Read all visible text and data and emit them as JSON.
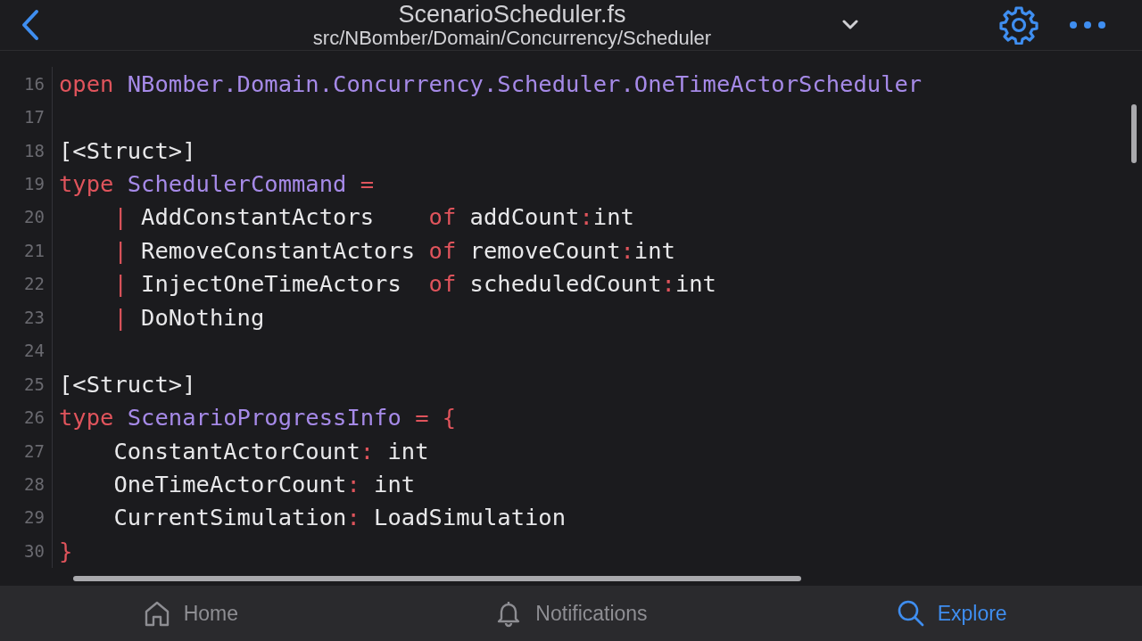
{
  "header": {
    "title": "ScenarioScheduler.fs",
    "path": "src/NBomber/Domain/Concurrency/Scheduler"
  },
  "code": {
    "lines": [
      {
        "number": "16",
        "tokens": [
          {
            "text": "open ",
            "kind": "keyword"
          },
          {
            "text": "NBomber.Domain.Concurrency.Scheduler.OneTimeActorScheduler",
            "kind": "type"
          }
        ]
      },
      {
        "number": "17"
      },
      {
        "number": "18",
        "tokens": [
          {
            "text": "[<Struct>]",
            "kind": "plain"
          }
        ]
      },
      {
        "number": "19",
        "tokens": [
          {
            "text": "type ",
            "kind": "keyword"
          },
          {
            "text": "SchedulerCommand",
            "kind": "type"
          },
          {
            "text": " =",
            "kind": "keyword"
          }
        ]
      },
      {
        "number": "20",
        "tokens": [
          {
            "text": "    |",
            "kind": "keyword"
          },
          {
            "text": " AddConstantActors    ",
            "kind": "plain"
          },
          {
            "text": "of",
            "kind": "keyword"
          },
          {
            "text": " addCount",
            "kind": "plain"
          },
          {
            "text": ":",
            "kind": "keyword"
          },
          {
            "text": "int",
            "kind": "plain"
          }
        ]
      },
      {
        "number": "21",
        "tokens": [
          {
            "text": "    |",
            "kind": "keyword"
          },
          {
            "text": " RemoveConstantActors ",
            "kind": "plain"
          },
          {
            "text": "of",
            "kind": "keyword"
          },
          {
            "text": " removeCount",
            "kind": "plain"
          },
          {
            "text": ":",
            "kind": "keyword"
          },
          {
            "text": "int",
            "kind": "plain"
          }
        ]
      },
      {
        "number": "22",
        "tokens": [
          {
            "text": "    |",
            "kind": "keyword"
          },
          {
            "text": " InjectOneTimeActors  ",
            "kind": "plain"
          },
          {
            "text": "of",
            "kind": "keyword"
          },
          {
            "text": " scheduledCount",
            "kind": "plain"
          },
          {
            "text": ":",
            "kind": "keyword"
          },
          {
            "text": "int",
            "kind": "plain"
          }
        ]
      },
      {
        "number": "23",
        "tokens": [
          {
            "text": "    |",
            "kind": "keyword"
          },
          {
            "text": " DoNothing",
            "kind": "plain"
          }
        ]
      },
      {
        "number": "24"
      },
      {
        "number": "25",
        "tokens": [
          {
            "text": "[<Struct>]",
            "kind": "plain"
          }
        ]
      },
      {
        "number": "26",
        "tokens": [
          {
            "text": "type ",
            "kind": "keyword"
          },
          {
            "text": "ScenarioProgressInfo",
            "kind": "type"
          },
          {
            "text": " = {",
            "kind": "keyword"
          }
        ]
      },
      {
        "number": "27",
        "tokens": [
          {
            "text": "    ConstantActorCount",
            "kind": "plain"
          },
          {
            "text": ":",
            "kind": "keyword"
          },
          {
            "text": " int",
            "kind": "plain"
          }
        ]
      },
      {
        "number": "28",
        "tokens": [
          {
            "text": "    OneTimeActorCount",
            "kind": "plain"
          },
          {
            "text": ":",
            "kind": "keyword"
          },
          {
            "text": " int",
            "kind": "plain"
          }
        ]
      },
      {
        "number": "29",
        "tokens": [
          {
            "text": "    CurrentSimulation",
            "kind": "plain"
          },
          {
            "text": ":",
            "kind": "keyword"
          },
          {
            "text": " LoadSimulation",
            "kind": "plain"
          }
        ]
      },
      {
        "number": "30",
        "tokens": [
          {
            "text": "}",
            "kind": "keyword"
          }
        ]
      }
    ]
  },
  "tab_bar": [
    {
      "label": "Home",
      "selected": false
    },
    {
      "label": "Notifications",
      "selected": false
    },
    {
      "label": "Explore",
      "selected": true
    }
  ]
}
